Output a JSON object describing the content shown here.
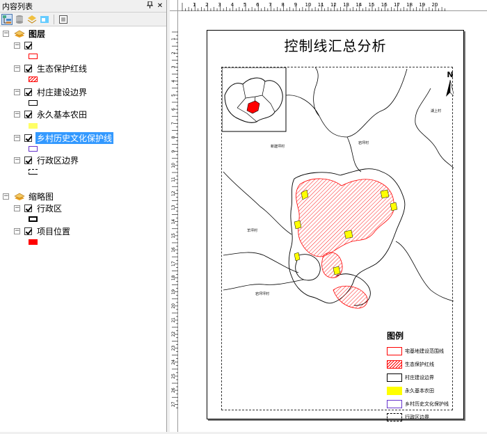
{
  "toc": {
    "title": "内容列表",
    "pin_glyph": "ᵖ",
    "close_glyph": "✕",
    "groups": [
      {
        "label": "图层",
        "layers": [
          {
            "label": "",
            "symbol_color": "#ff0000",
            "symbol_type": "outline",
            "selected": false
          },
          {
            "label": "生态保护红线",
            "symbol_color": "#ff0000",
            "symbol_type": "hatch",
            "selected": false
          },
          {
            "label": "村庄建设边界",
            "symbol_color": "#000000",
            "symbol_type": "outline",
            "selected": false
          },
          {
            "label": "永久基本农田",
            "symbol_color": "#ffff66",
            "symbol_type": "fill",
            "selected": false
          },
          {
            "label": "乡村历史文化保护线",
            "symbol_color": "#6633cc",
            "symbol_type": "outline",
            "selected": true
          },
          {
            "label": "行政区边界",
            "symbol_color": "#000000",
            "symbol_type": "dashed",
            "selected": false
          }
        ]
      },
      {
        "label": "缩略图",
        "layers": [
          {
            "label": "行政区",
            "symbol_color": "#000000",
            "symbol_type": "outline-thick",
            "selected": false
          },
          {
            "label": "项目位置",
            "symbol_color": "#ff0000",
            "symbol_type": "fill",
            "selected": false
          }
        ]
      }
    ]
  },
  "layout": {
    "ruler_top_labels": [
      "1",
      "2",
      "3",
      "4",
      "5",
      "6",
      "7",
      "8",
      "9",
      "10",
      "11",
      "12",
      "13",
      "14",
      "15",
      "16",
      "17",
      "18",
      "19",
      "20"
    ],
    "ruler_left_labels": [
      "1",
      "2",
      "3",
      "4",
      "5",
      "6",
      "7",
      "8",
      "9",
      "10",
      "11",
      "12",
      "13",
      "14",
      "15",
      "16",
      "17",
      "18",
      "19",
      "20",
      "21",
      "22",
      "23",
      "24",
      "25",
      "26",
      "27"
    ],
    "map": {
      "title": "控制线汇总分析",
      "north_label": "N",
      "place_labels": [
        "新建坪村",
        "岩坪村",
        "湖上村",
        "羊坪村",
        "岩坪坪村"
      ],
      "legend": {
        "title": "图例",
        "items": [
          {
            "label": "宅基地建设范围线",
            "type": "outline",
            "color": "#ff0000"
          },
          {
            "label": "生态保护红线",
            "type": "hatch",
            "color": "#ff0000"
          },
          {
            "label": "村庄建设边界",
            "type": "outline",
            "color": "#000000"
          },
          {
            "label": "永久基本农田",
            "type": "fill",
            "color": "#ffff00"
          },
          {
            "label": "乡村历史文化保护线",
            "type": "outline",
            "color": "#6633cc"
          },
          {
            "label": "行政区边界",
            "type": "dashed",
            "color": "#000000"
          }
        ]
      }
    }
  }
}
